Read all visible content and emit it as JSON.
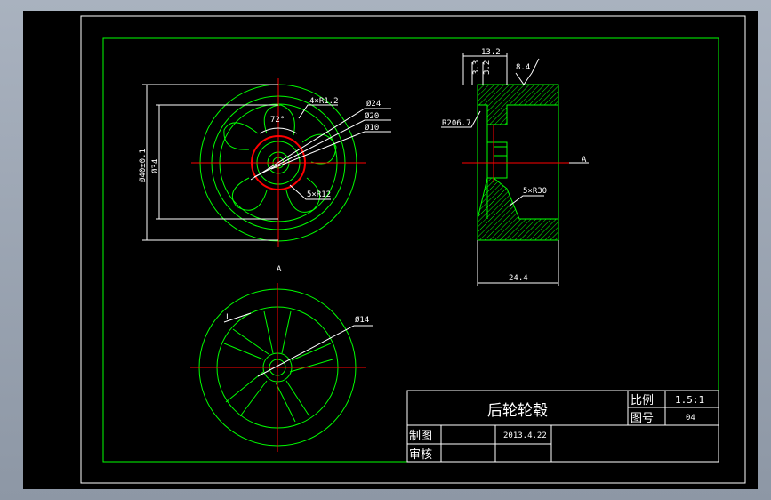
{
  "colors": {
    "geometry": "#00ff00",
    "centerline": "#ff0000",
    "dimension": "#ffffff",
    "border": "#ffffff",
    "background": "#000000"
  },
  "front_view": {
    "dims": {
      "fillet": "4×R1.2",
      "angle": "72°",
      "dia_24": "Ø24",
      "dia_20": "Ø20",
      "dia_10": "Ø10",
      "slots": "5×R12",
      "dia_40": "Ø40±0.1",
      "dia_34": "Ø34"
    }
  },
  "section_view": {
    "dims": {
      "top_width": "13.2",
      "step_a": "3.3",
      "step_b": "3.2",
      "roughness": "8.4",
      "radius": "R206.7",
      "fillet": "5×R30",
      "width": "24.4",
      "section_mark": "A"
    }
  },
  "rear_view": {
    "dims": {
      "dia_14": "Ø14",
      "spoke_label": "L",
      "section_mark": "A"
    }
  },
  "title_block": {
    "part_name": "后轮轮毂",
    "scale_label": "比例",
    "scale_value": "1.5:1",
    "drawing_no_label": "图号",
    "drawing_no_value": "04",
    "drawn_by_label": "制图",
    "date": "2013.4.22",
    "checked_by_label": "审核"
  }
}
